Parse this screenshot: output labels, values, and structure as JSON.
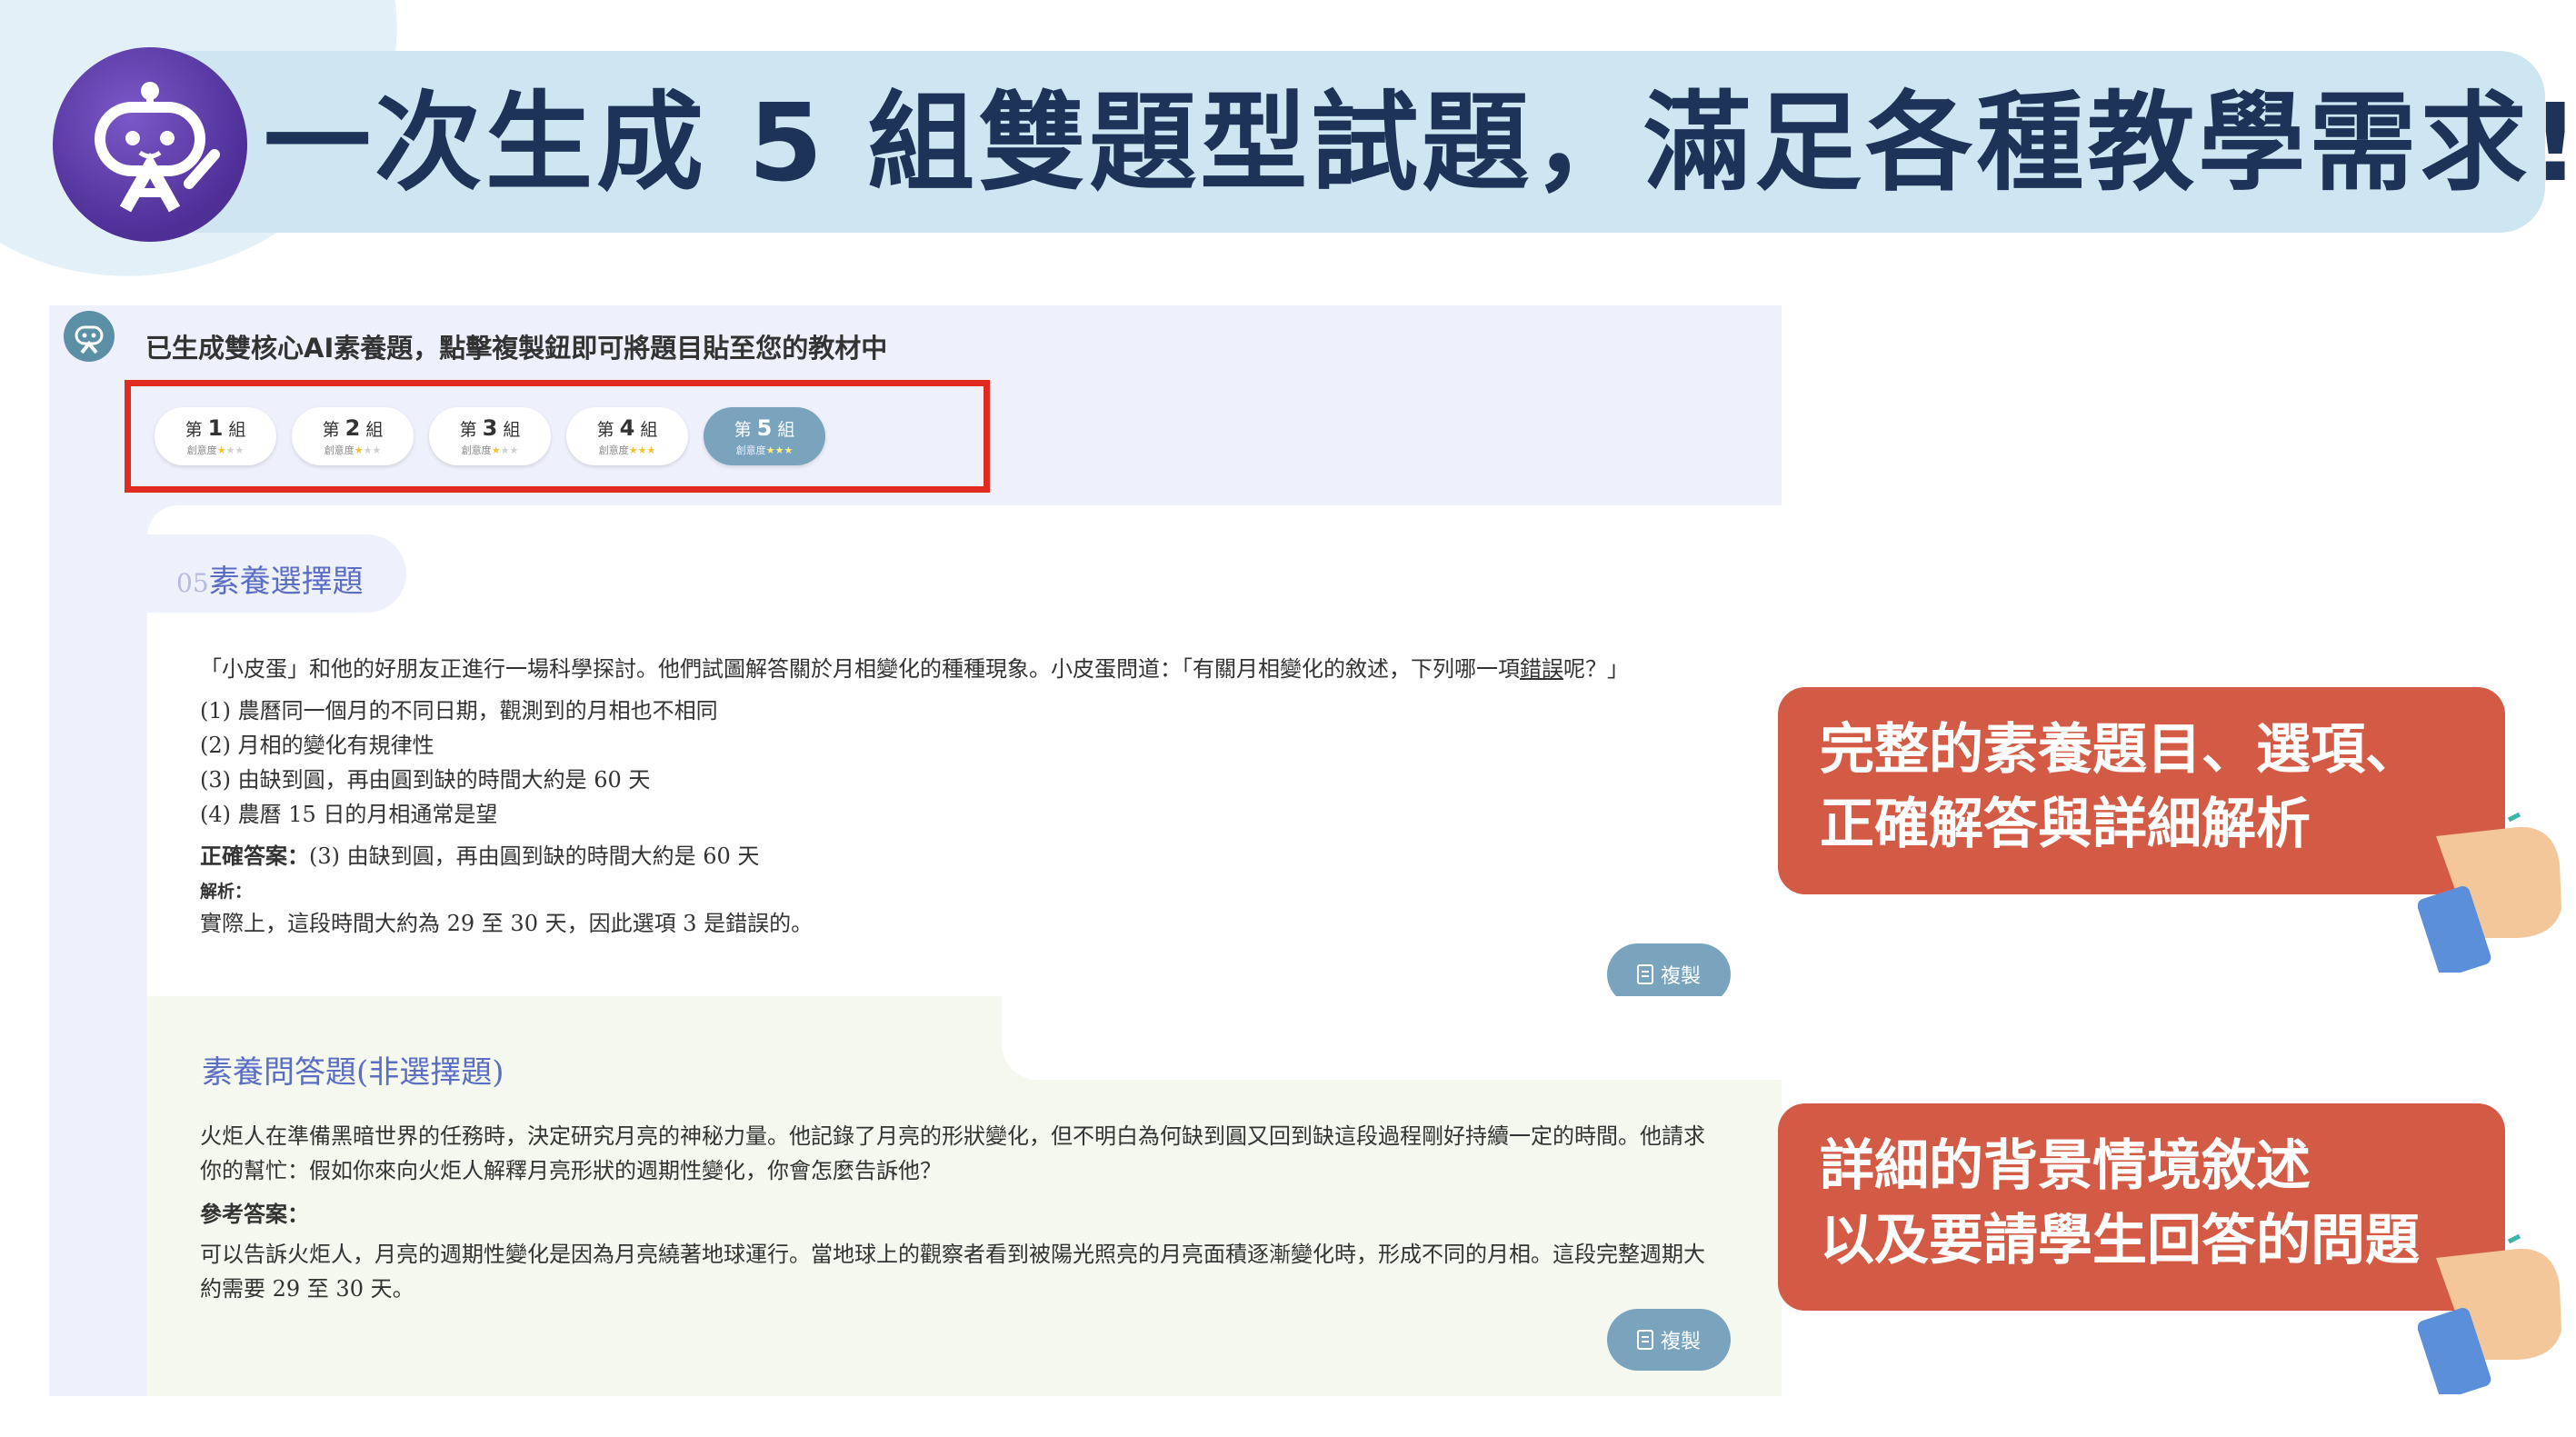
{
  "header": {
    "title": "一次生成 5 組雙題型試題，滿足各種教學需求!"
  },
  "app": {
    "intro": "已生成雙核心AI素養題，點擊複製鈕即可將題目貼至您的教材中",
    "group_prefix": "第",
    "group_suffix": "組",
    "creativity_label": "創意度",
    "groups": [
      {
        "number": "1",
        "stars": 1,
        "active": false
      },
      {
        "number": "2",
        "stars": 1,
        "active": false
      },
      {
        "number": "3",
        "stars": 1,
        "active": false
      },
      {
        "number": "4",
        "stars": 3,
        "active": false
      },
      {
        "number": "5",
        "stars": 3,
        "active": true
      }
    ],
    "max_stars": 3
  },
  "question1": {
    "index": "05",
    "tab_label": "素養選擇題",
    "stem_prefix": "「小皮蛋」和他的好朋友正進行一場科學探討。他們試圖解答關於月相變化的種種現象。小皮蛋問道：「有關月相變化的敘述，下列哪一項",
    "stem_underlined": "錯誤",
    "stem_suffix": "呢？」",
    "options": [
      "(1) 農曆同一個月的不同日期，觀測到的月相也不相同",
      "(2) 月相的變化有規律性",
      "(3) 由缺到圓，再由圓到缺的時間大約是 60 天",
      "(4) 農曆 15 日的月相通常是望"
    ],
    "answer_label": "正確答案：",
    "answer_text": "(3) 由缺到圓，再由圓到缺的時間大約是 60 天",
    "explanation_label": "解析：",
    "explanation_text": "實際上，這段時間大約為 29 至 30 天，因此選項 3 是錯誤的。",
    "copy_label": "複製"
  },
  "question2": {
    "tab_label": "素養問答題(非選擇題)",
    "stem_line1": "火炬人在準備黑暗世界的任務時，決定研究月亮的神秘力量。他記錄了月亮的形狀變化，但不明白為何缺到圓又回到缺這段過程剛好持續一定的時間。他請求",
    "stem_line2": "你的幫忙：假如你來向火炬人解釋月亮形狀的週期性變化，你會怎麼告訴他？",
    "answer_label": "參考答案：",
    "answer_line1": "可以告訴火炬人，月亮的週期性變化是因為月亮繞著地球運行。當地球上的觀察者看到被陽光照亮的月亮面積逐漸變化時，形成不同的月相。這段完整週期大",
    "answer_line2": "約需要 29 至 30 天。",
    "copy_label": "複製"
  },
  "callouts": [
    {
      "line1": "完整的素養題目、選項、",
      "line2": "正確解答與詳細解析"
    },
    {
      "line1": "詳細的背景情境敘述",
      "line2": "以及要請學生回答的問題"
    }
  ],
  "colors": {
    "banner": "#cde6f1",
    "title": "#1d3357",
    "accent_red": "#e12b20",
    "callout": "#d35b45",
    "copy_button": "#7aa4bd",
    "tab_text": "#5b6ec4"
  }
}
